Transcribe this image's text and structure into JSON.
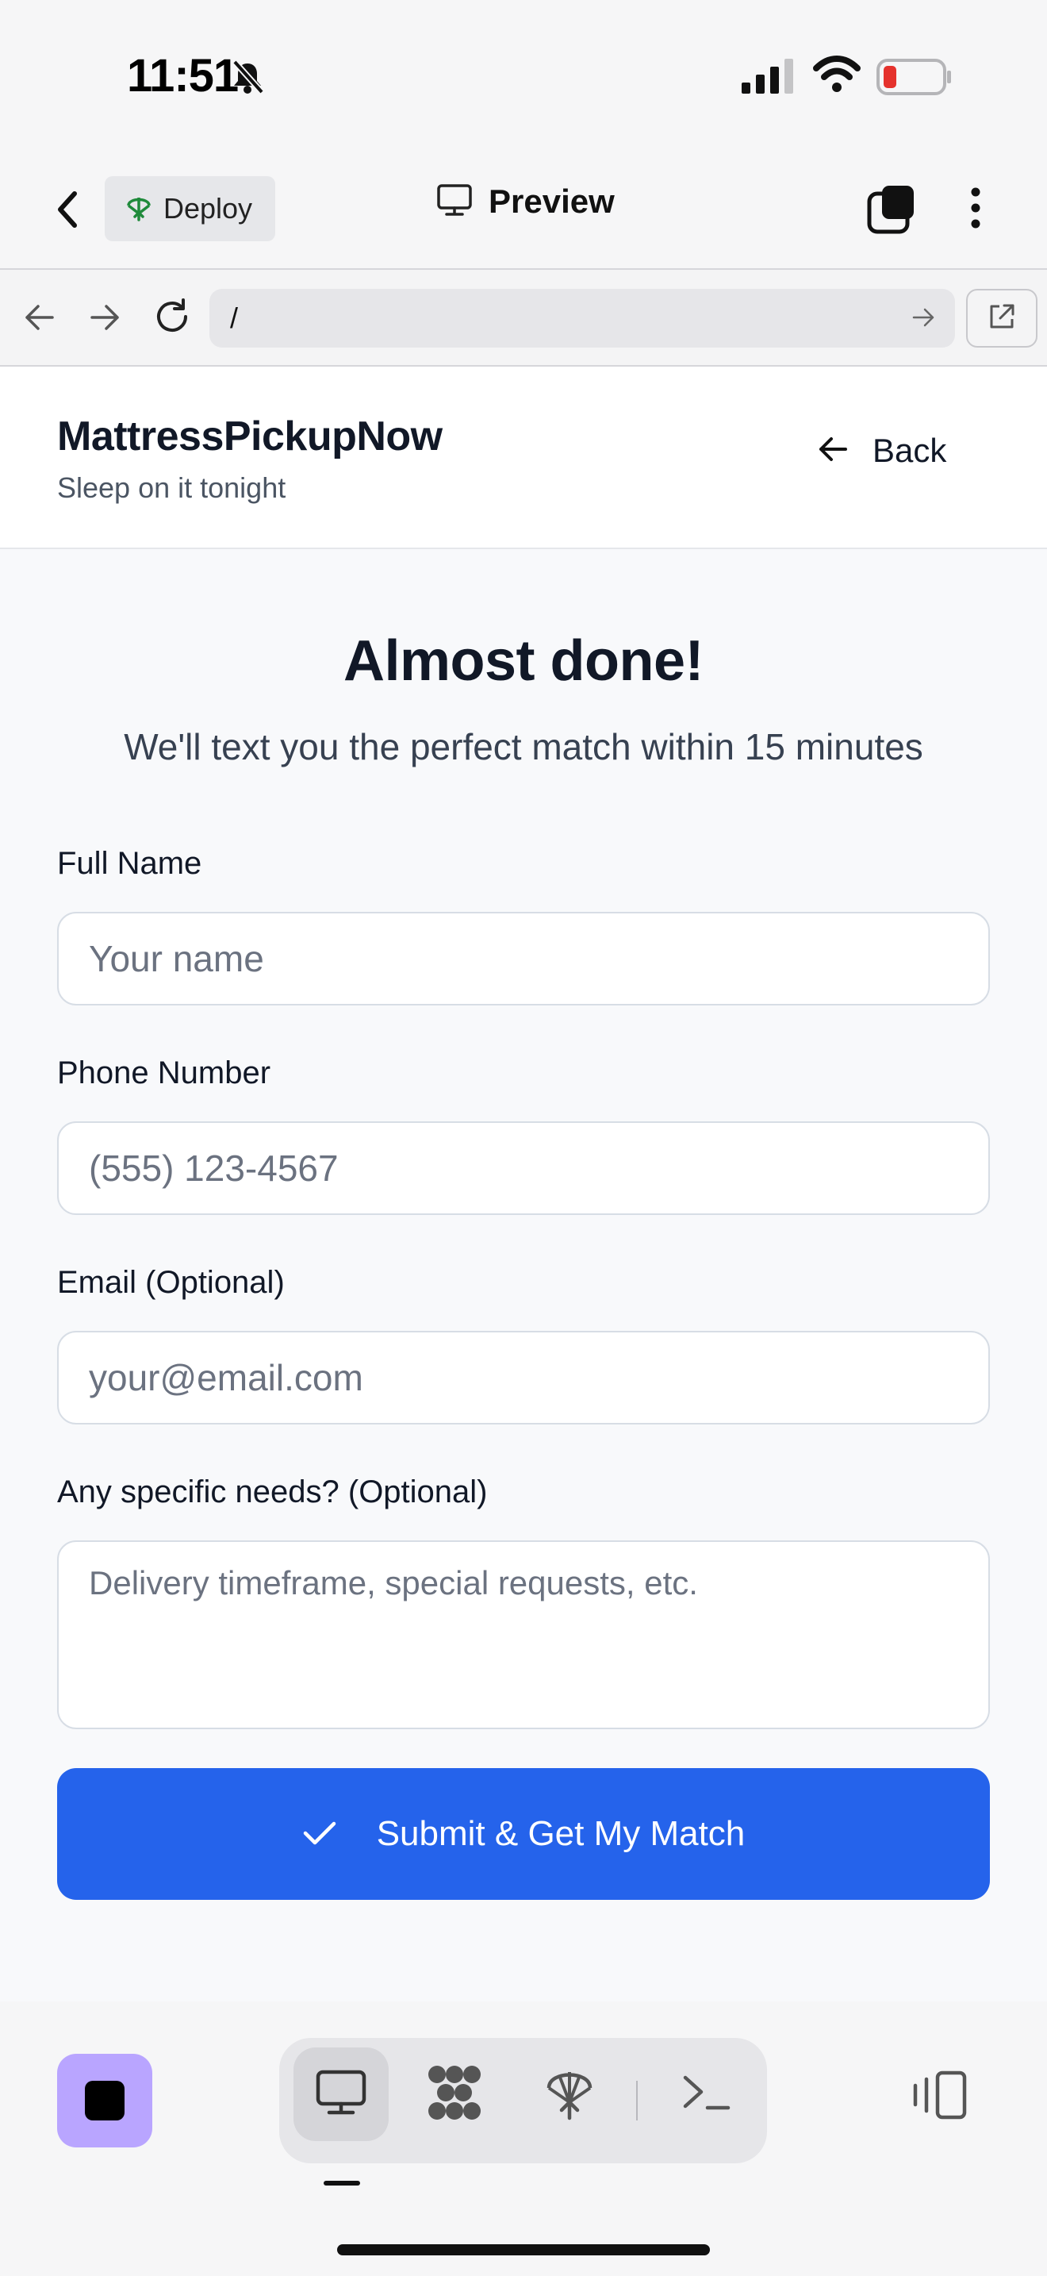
{
  "status_bar": {
    "time": "11:51",
    "icons": [
      "bell-slash-icon",
      "cellular-signal-icon",
      "wifi-icon",
      "battery-low-icon"
    ],
    "battery_color": "#e5322d"
  },
  "app_bar": {
    "deploy_label": "Deploy",
    "preview_label": "Preview",
    "icons": [
      "chevron-left-icon",
      "deploy-icon",
      "monitor-icon",
      "tabs-icon",
      "more-vertical-icon"
    ]
  },
  "browser_bar": {
    "url": "/",
    "icons": [
      "arrow-left-icon",
      "arrow-right-icon",
      "reload-icon",
      "go-arrow-icon",
      "external-link-icon"
    ]
  },
  "site_header": {
    "brand_name": "MattressPickupNow",
    "tagline": "Sleep on it tonight",
    "back_label": "Back"
  },
  "form": {
    "title": "Almost done!",
    "subtitle": "We'll text you the perfect match within 15 minutes",
    "fields": [
      {
        "label": "Full Name",
        "placeholder": "Your name",
        "value": ""
      },
      {
        "label": "Phone Number",
        "placeholder": "(555) 123-4567",
        "value": ""
      },
      {
        "label": "Email (Optional)",
        "placeholder": "your@email.com",
        "value": ""
      },
      {
        "label": "Any specific needs? (Optional)",
        "placeholder": "Delivery timeframe, special requests, etc.",
        "value": ""
      }
    ],
    "submit_label": "Submit & Get My Match",
    "accent_color": "#2563eb"
  },
  "bottom_bar": {
    "stop_color": "#b9a5ff",
    "tools": [
      "monitor-icon",
      "extensions-icon",
      "deploy-icon",
      "terminal-icon"
    ],
    "active_tool": "monitor-icon",
    "right_icon": "layout-toggle-icon"
  }
}
